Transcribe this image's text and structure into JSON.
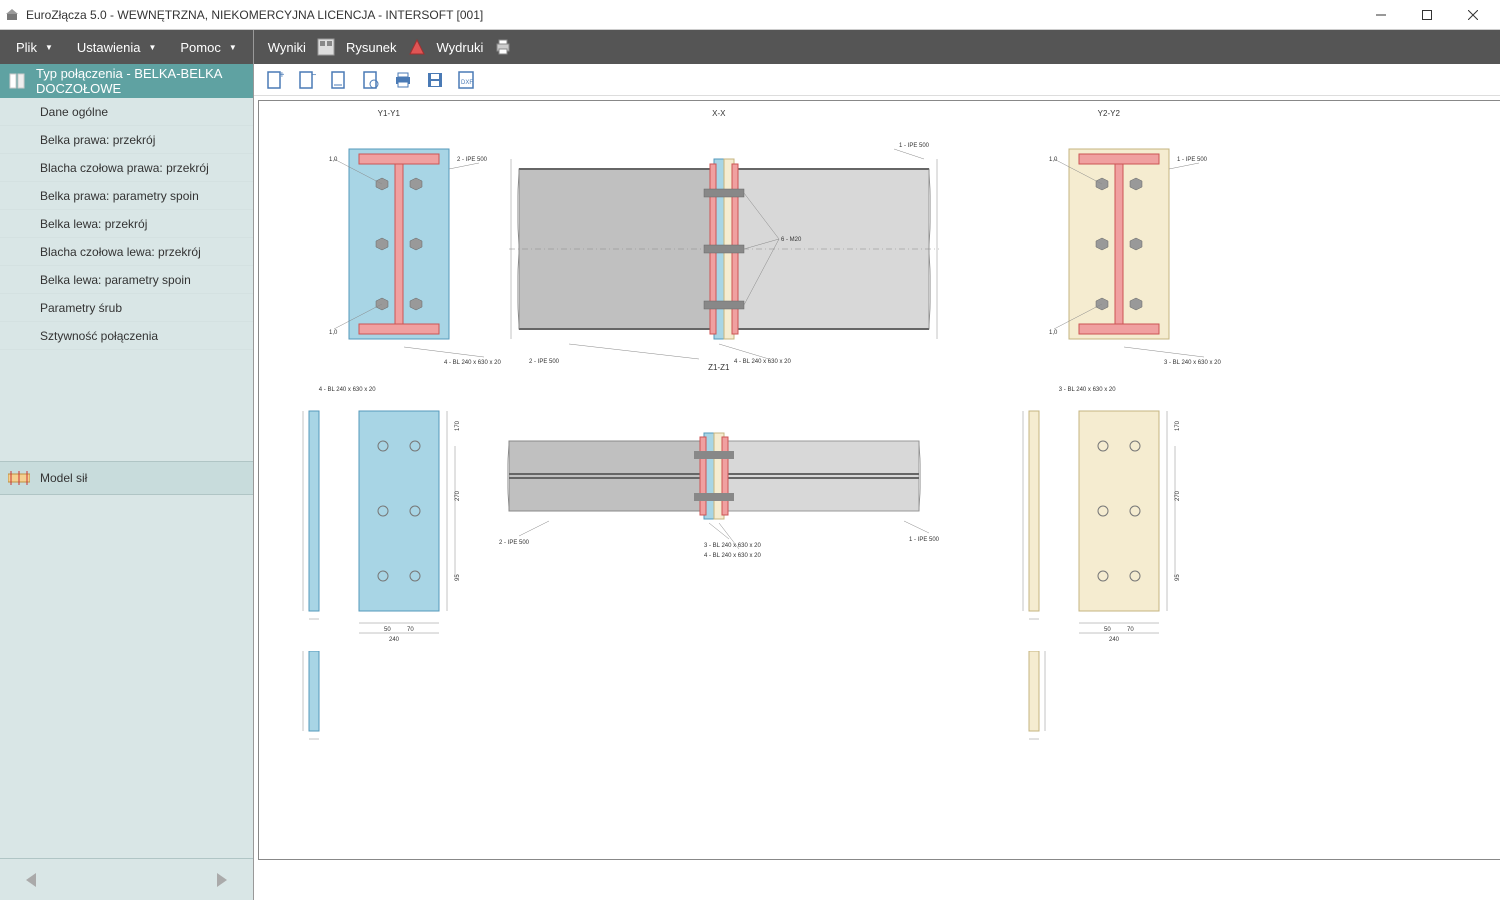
{
  "window": {
    "title": "EuroZłącza 5.0 - WEWNĘTRZNA, NIEKOMERCYJNA LICENCJA - INTERSOFT [001]"
  },
  "menubar": {
    "items": [
      "Plik",
      "Ustawienia",
      "Pomoc"
    ]
  },
  "sidebar": {
    "header": "Typ połączenia - BELKA-BELKA DOCZOŁOWE",
    "items": [
      "Dane ogólne",
      "Belka prawa: przekrój",
      "Blacha czołowa prawa: przekrój",
      "Belka prawa: parametry spoin",
      "Belka lewa: przekrój",
      "Blacha czołowa lewa: przekrój",
      "Belka lewa: parametry spoin",
      "Parametry śrub",
      "Sztywność połączenia"
    ],
    "footer_item": "Model sił"
  },
  "toolbar": {
    "wyniki": "Wyniki",
    "rysunek": "Rysunek",
    "wydruki": "Wydruki"
  },
  "drawing": {
    "sections": {
      "y1": "Y1-Y1",
      "xx": "X-X",
      "y2": "Y2-Y2",
      "z1": "Z1-Z1"
    },
    "labels": {
      "plate_left": "4 - BL 240 x 630 x 20",
      "plate_right": "3 - BL 240 x 630 x 20",
      "ipe_left": "2 - IPE 500",
      "ipe_right": "1 - IPE 500",
      "bolts": "6 - M20",
      "dim_50": "50",
      "dim_70": "70",
      "dim_240": "240",
      "dim_170": "170",
      "dim_270": "270",
      "dim_95": "95"
    }
  },
  "doc_toolbar": {
    "dxf_label": "DXF"
  }
}
